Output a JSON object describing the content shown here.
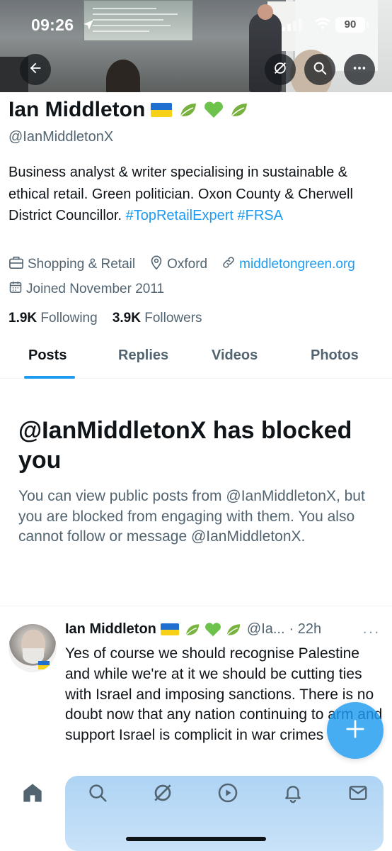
{
  "status_bar": {
    "time": "09:26",
    "battery": "90"
  },
  "header": {
    "back_icon": "arrow-left-icon",
    "grok_icon": "grok-icon",
    "search_icon": "search-icon",
    "more_icon": "more-icon"
  },
  "profile": {
    "name": "Ian Middleton",
    "name_badges": "🍃💚🍃",
    "handle": "@IanMiddletonX",
    "bio_text": "Business analyst & writer specialising in sustainable & ethical retail. Green politician. Oxon County & Cherwell District Councillor.",
    "bio_tags": [
      "#TopRetailExpert",
      "#FRSA"
    ],
    "category": "Shopping & Retail",
    "location": "Oxford",
    "website": "middletongreen.org",
    "joined": "Joined November 2011",
    "following_count": "1.9K",
    "following_label": "Following",
    "followers_count": "3.9K",
    "followers_label": "Followers"
  },
  "tabs": [
    {
      "label": "Posts",
      "active": true
    },
    {
      "label": "Replies",
      "active": false
    },
    {
      "label": "Videos",
      "active": false
    },
    {
      "label": "Photos",
      "active": false
    }
  ],
  "blocked": {
    "title": "@IanMiddletonX has blocked you",
    "body": "You can view public posts from @IanMiddletonX, but you are blocked from engaging with them. You also cannot follow or message @IanMiddletonX."
  },
  "post": {
    "author": "Ian Middleton",
    "badges": "🍃💚🍃",
    "handle_truncated": "@Ia...",
    "time": "· 22h",
    "more": "···",
    "text": "Yes of course we should recognise Palestine and while we're at it we should be cutting ties with Israel and imposing sanctions. There is no doubt now that any nation continuing to arm and support Israel is complicit in war crimes"
  },
  "fab": {
    "icon": "plus-icon"
  },
  "bottom_nav": [
    "home-icon",
    "search-icon",
    "grok-icon",
    "video-icon",
    "bell-icon",
    "mail-icon"
  ],
  "colors": {
    "accent": "#1d9bf0",
    "text": "#0f1419",
    "secondary": "#536471"
  }
}
